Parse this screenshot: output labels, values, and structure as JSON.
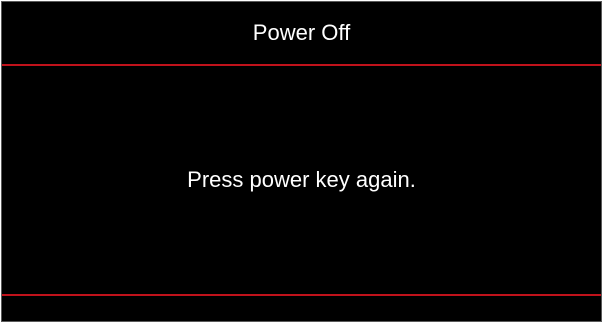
{
  "dialog": {
    "title": "Power Off",
    "message": "Press power key again."
  },
  "colors": {
    "background": "#000000",
    "text": "#ffffff",
    "divider": "#c0121b",
    "frame_border": "#5a5a5a"
  }
}
